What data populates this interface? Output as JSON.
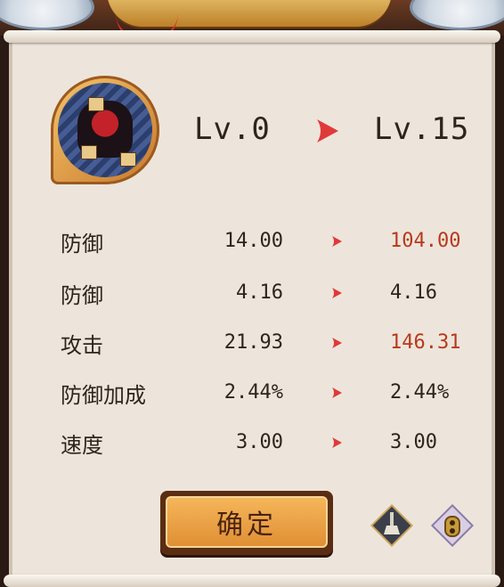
{
  "header": {
    "level_from": "Lv.0",
    "level_to": "Lv.15"
  },
  "stats": [
    {
      "label": "防御",
      "old": "14.00",
      "new": "104.00",
      "changed": true
    },
    {
      "label": "防御",
      "old": "4.16",
      "new": "4.16",
      "changed": false
    },
    {
      "label": "攻击",
      "old": "21.93",
      "new": "146.31",
      "changed": true
    },
    {
      "label": "防御加成",
      "old": "2.44%",
      "new": "2.44%",
      "changed": false
    },
    {
      "label": "速度",
      "old": "3.00",
      "new": "3.00",
      "changed": false
    }
  ],
  "buttons": {
    "confirm_label": "确定",
    "broom_icon": "broom-icon",
    "lock_icon": "lock-icon"
  },
  "colors": {
    "arrow": "#e0393a",
    "changed_value": "#b8391c",
    "text": "#2e241e",
    "button": "#f0a447"
  }
}
